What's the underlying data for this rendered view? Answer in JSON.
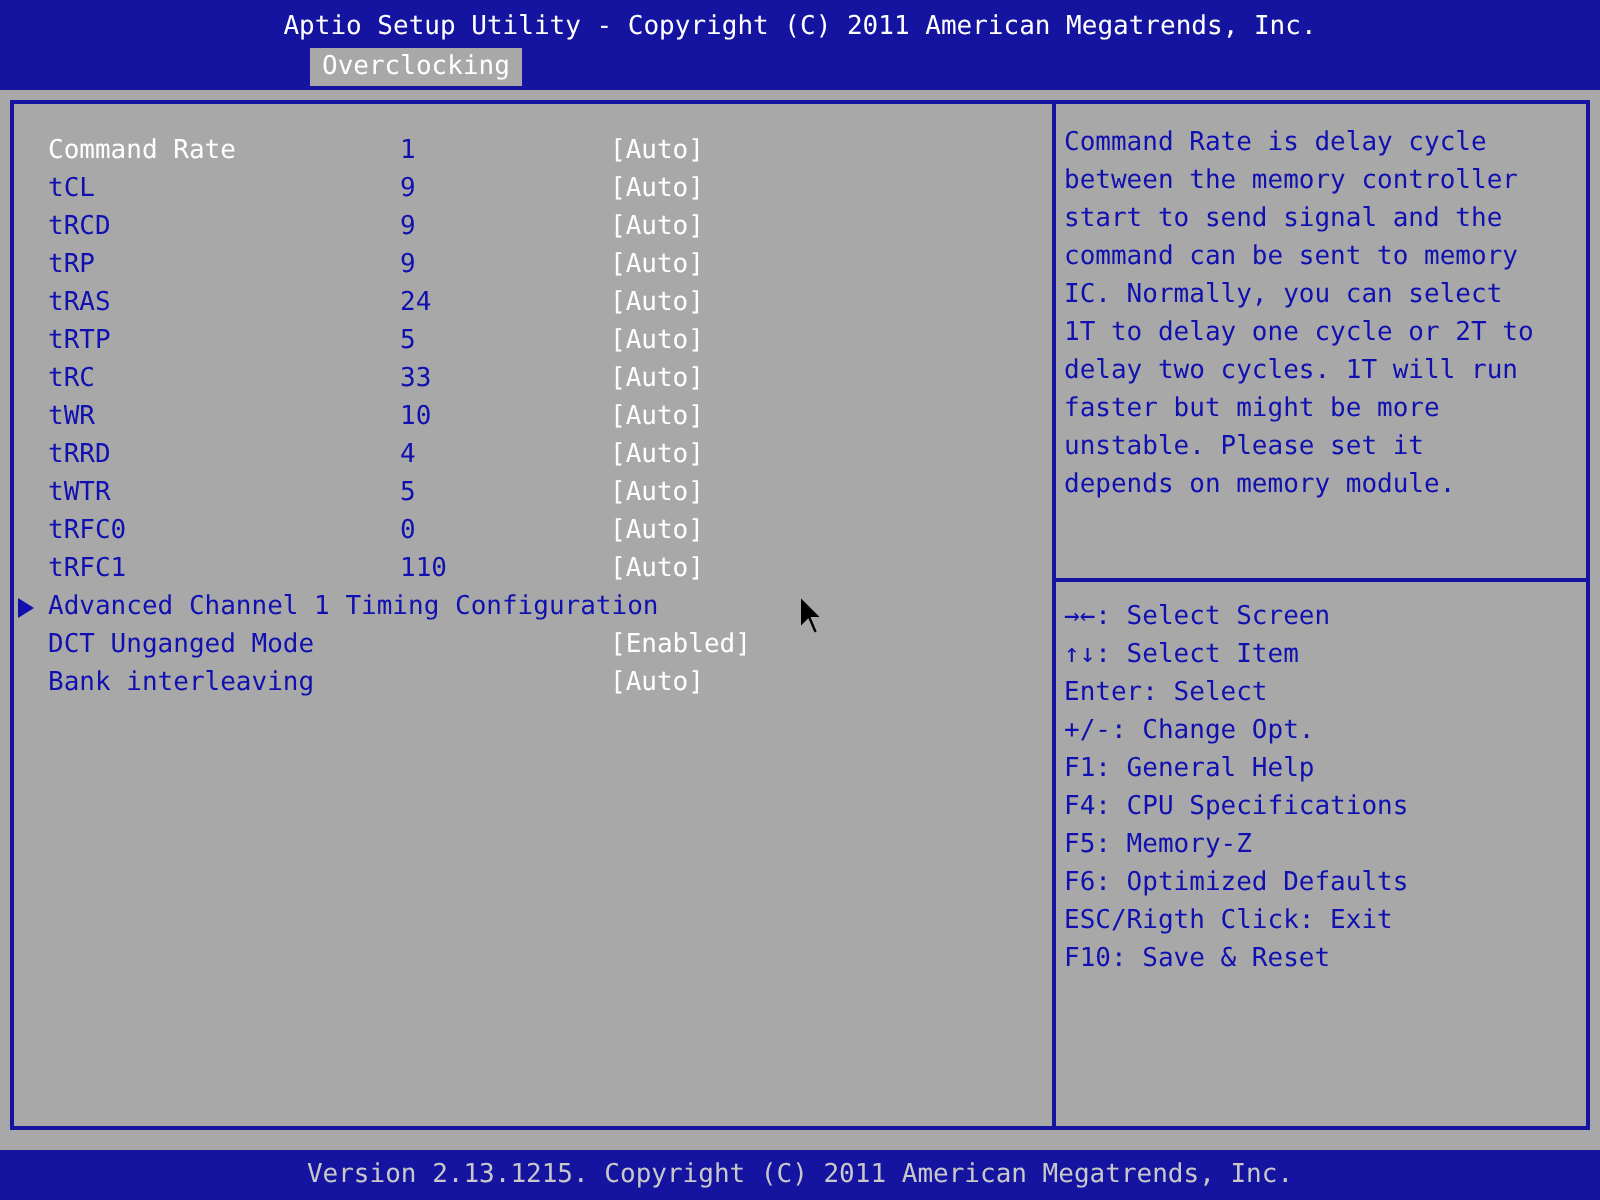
{
  "header": {
    "title": "Aptio Setup Utility - Copyright (C) 2011 American Megatrends, Inc.",
    "tabs": [
      {
        "label": "Overclocking",
        "selected": true
      }
    ]
  },
  "items": [
    {
      "kind": "setting",
      "label": "Command Rate",
      "value": "1",
      "option": "[Auto]",
      "selected": true
    },
    {
      "kind": "setting",
      "label": "tCL",
      "value": "9",
      "option": "[Auto]",
      "selected": false
    },
    {
      "kind": "setting",
      "label": "tRCD",
      "value": "9",
      "option": "[Auto]",
      "selected": false
    },
    {
      "kind": "setting",
      "label": "tRP",
      "value": "9",
      "option": "[Auto]",
      "selected": false
    },
    {
      "kind": "setting",
      "label": "tRAS",
      "value": "24",
      "option": "[Auto]",
      "selected": false
    },
    {
      "kind": "setting",
      "label": "tRTP",
      "value": "5",
      "option": "[Auto]",
      "selected": false
    },
    {
      "kind": "setting",
      "label": "tRC",
      "value": "33",
      "option": "[Auto]",
      "selected": false
    },
    {
      "kind": "setting",
      "label": "tWR",
      "value": "10",
      "option": "[Auto]",
      "selected": false
    },
    {
      "kind": "setting",
      "label": "tRRD",
      "value": "4",
      "option": "[Auto]",
      "selected": false
    },
    {
      "kind": "setting",
      "label": "tWTR",
      "value": "5",
      "option": "[Auto]",
      "selected": false
    },
    {
      "kind": "setting",
      "label": "tRFC0",
      "value": "0",
      "option": "[Auto]",
      "selected": false
    },
    {
      "kind": "setting",
      "label": "tRFC1",
      "value": "110",
      "option": "[Auto]",
      "selected": false
    },
    {
      "kind": "submenu",
      "label": "Advanced Channel 1 Timing Configuration",
      "selected": false
    },
    {
      "kind": "setting",
      "label": "DCT Unganged Mode",
      "option": "[Enabled]",
      "selected": false
    },
    {
      "kind": "setting",
      "label": "Bank interleaving",
      "option": "[Auto]",
      "selected": false
    }
  ],
  "help": {
    "description": [
      "Command Rate is delay cycle",
      "between the memory controller",
      "start to send signal and the",
      "command can be sent to memory",
      "IC. Normally, you can select",
      "1T to delay one cycle or 2T to",
      "delay two cycles. 1T will run",
      "faster but might be more",
      "unstable. Please set it",
      "depends on memory module."
    ],
    "keys": [
      "→←: Select Screen",
      "↑↓: Select Item",
      "Enter: Select",
      "+/-: Change Opt.",
      "F1: General Help",
      "F4: CPU Specifications",
      "F5: Memory-Z",
      "F6: Optimized Defaults",
      "ESC/Rigth Click: Exit",
      "F10: Save & Reset"
    ]
  },
  "footer": {
    "text": "Version 2.13.1215. Copyright (C) 2011 American Megatrends, Inc."
  }
}
